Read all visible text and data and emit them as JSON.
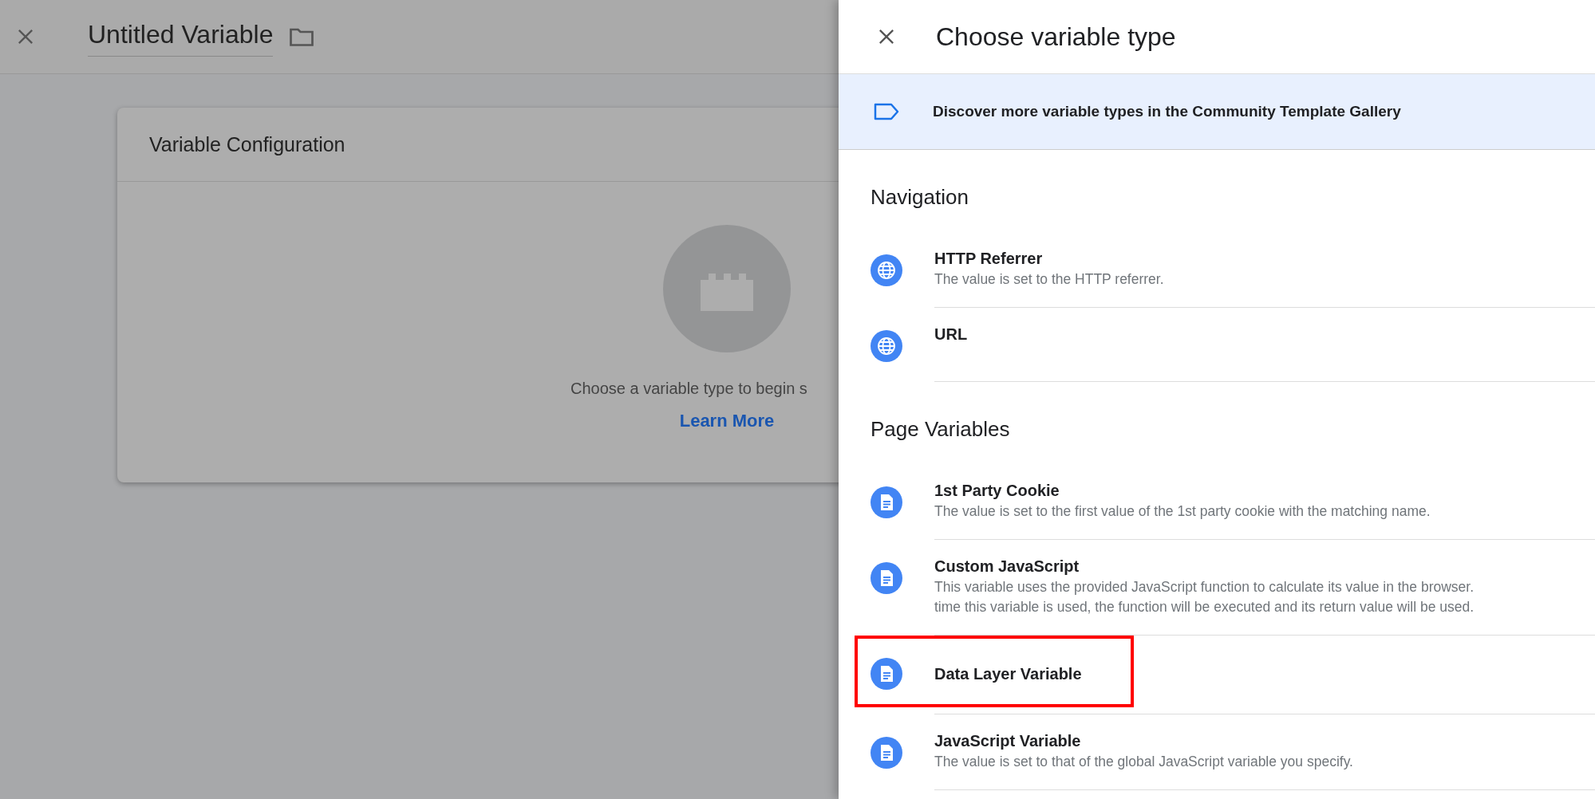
{
  "editor": {
    "title": "Untitled Variable",
    "card": {
      "heading": "Variable Configuration",
      "prompt": "Choose a variable type to begin s",
      "link": "Learn More"
    }
  },
  "panel": {
    "title": "Choose variable type",
    "banner": "Discover more variable types in the Community Template Gallery",
    "sections": [
      {
        "heading": "Navigation",
        "items": [
          {
            "kind": "globe",
            "name": "HTTP Referrer",
            "description": [
              "The value is set to the HTTP referrer."
            ],
            "highlighted": false
          },
          {
            "kind": "globe",
            "name": "URL",
            "highlighted": false
          }
        ]
      },
      {
        "heading": "Page Variables",
        "items": [
          {
            "kind": "document",
            "name": "1st Party Cookie",
            "description": [
              "The value is set to the first value of the 1st party cookie with the matching name."
            ],
            "highlighted": false
          },
          {
            "kind": "document",
            "name": "Custom JavaScript",
            "description": [
              "This variable uses the provided JavaScript function to calculate its value in the browser.",
              "time this variable is used, the function will be executed and its return value will be used."
            ],
            "highlighted": false
          },
          {
            "kind": "document",
            "name": "Data Layer Variable",
            "highlighted": true
          },
          {
            "kind": "document",
            "name": "JavaScript Variable",
            "description": [
              "The value is set to that of the global JavaScript variable you specify."
            ],
            "highlighted": false
          }
        ]
      }
    ]
  }
}
